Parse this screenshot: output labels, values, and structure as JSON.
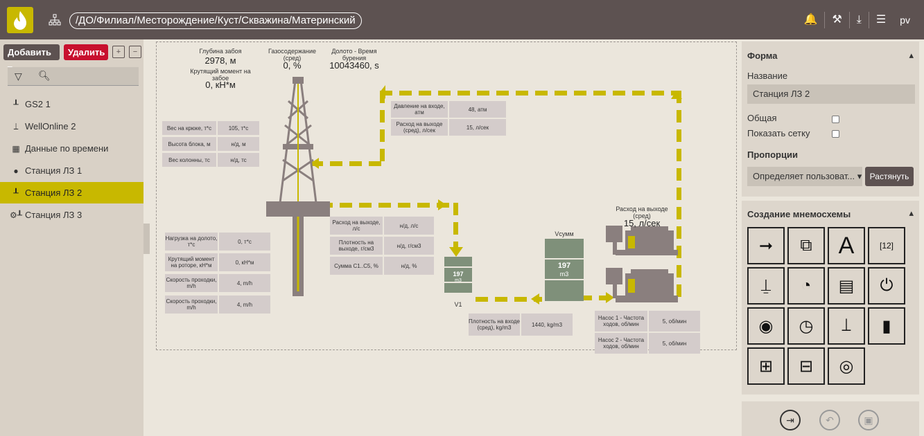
{
  "topbar": {
    "path": "/ДО/Филиал/Месторождение/Куст/Скважина/Материнский",
    "user": "pv"
  },
  "sidebar": {
    "add_label": "Добавить ▾",
    "delete_label": "Удалить",
    "items": [
      {
        "label": "GS2 1",
        "icon": "rig-icon"
      },
      {
        "label": "WellOnline 2",
        "icon": "well-icon"
      },
      {
        "label": "Данные по времени",
        "icon": "table-icon"
      },
      {
        "label": "Станция ЛЗ 1",
        "icon": "station-icon"
      },
      {
        "label": "Станция ЛЗ 2",
        "icon": "rig-icon",
        "active": true
      },
      {
        "label": "Станция ЛЗ 3",
        "icon": "rig-icon"
      }
    ]
  },
  "scheme": {
    "depth_label": "Глубина забоя",
    "depth_value": "2978, м",
    "torque_label": "Крутящий момент на забое",
    "torque_value": "0, кН*м",
    "gas_label": "Газосодержание (сред)",
    "gas_value": "0, %",
    "bit_label": "Долото - Время бурения",
    "bit_value": "10043460, s",
    "left_table": [
      {
        "k": "Вес на крюке, т*с",
        "v": "105, т*с"
      },
      {
        "k": "Высота блока, м",
        "v": "н/д, м"
      },
      {
        "k": "Вес колонны, тс",
        "v": "н/д, тс"
      }
    ],
    "top_table": [
      {
        "k": "Давление на входе, атм",
        "v": "48, атм"
      },
      {
        "k": "Расход на выходе (сред), л/сек",
        "v": "15, л/сек"
      }
    ],
    "bottom_left_table": [
      {
        "k": "Нагрузка на долото, т*с",
        "v": "0, т*с"
      },
      {
        "k": "Крутящий момент на роторе, кН*м",
        "v": "0, кН*м"
      },
      {
        "k": "Скорость проходки, m/h",
        "v": "4, m/h"
      },
      {
        "k": "Скорость проходки, m/h",
        "v": "4, m/h"
      }
    ],
    "mid_table": [
      {
        "k": "Расход на выходе, л/с",
        "v": "н/д, л/с"
      },
      {
        "k": "Плотность на выходе, г/см3",
        "v": "н/д, г/см3"
      },
      {
        "k": "Сумма С1..С5, %",
        "v": "н/д, %"
      }
    ],
    "density_in": {
      "k": "Плотность на входе (сред), kg/m3",
      "v": "1440, kg/m3"
    },
    "pumps": [
      {
        "k": "Насос 1 - Частота ходов, об/мин",
        "v": "5, об/мин"
      },
      {
        "k": "Насос 2 - Частота ходов, об/мин",
        "v": "5, об/мин"
      }
    ],
    "tank_v1_value": "197",
    "tank_v1_unit": "m3",
    "tank_v1_label": "V1",
    "tank_sum_label": "Vсумм",
    "tank_sum_value": "197",
    "tank_sum_unit": "m3",
    "flow_out_label": "Расход на выходе (сред)",
    "flow_out_value": "15, л/сек"
  },
  "form": {
    "title": "Форма",
    "name_label": "Название",
    "name_value": "Станция ЛЗ 2",
    "common_label": "Общая",
    "grid_label": "Показать сетку",
    "proportions_label": "Пропорции",
    "proportions_value": "Определяет пользоват... ▾",
    "stretch_label": "Растянуть"
  },
  "builder": {
    "title": "Создание мнемосхемы"
  },
  "colors": {
    "accent": "#c8b800",
    "topbar": "#5d5251",
    "delete": "#c8102e"
  }
}
